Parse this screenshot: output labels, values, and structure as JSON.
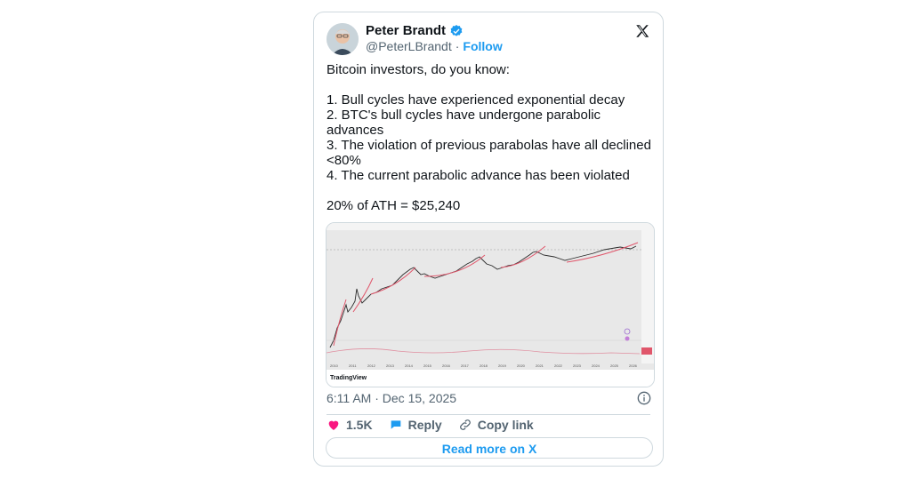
{
  "author": {
    "name": "Peter Brandt",
    "handle": "@PeterLBrandt",
    "separator": "·",
    "follow_label": "Follow"
  },
  "tweet": {
    "lines": [
      "Bitcoin investors, do you know:",
      "",
      "1. Bull cycles have experienced exponential decay",
      "2. BTC's bull cycles have undergone parabolic advances",
      "3. The violation of previous parabolas have all declined <80%",
      "4. The current parabolic advance has been violated",
      "",
      "20% of ATH = $25,240"
    ]
  },
  "media": {
    "footer_text": "TradingView",
    "x_ticks": [
      "2010",
      "2011",
      "2012",
      "2013",
      "2014",
      "2015",
      "2016",
      "2017",
      "2018",
      "2019",
      "2020",
      "2021",
      "2022",
      "2023",
      "2024",
      "2025",
      "2026"
    ]
  },
  "timestamp": {
    "time": "6:11 AM",
    "separator": "·",
    "date": "Dec 15, 2025"
  },
  "actions": {
    "likes": "1.5K",
    "reply_label": "Reply",
    "copy_label": "Copy link"
  },
  "read_more_label": "Read more on X",
  "colors": {
    "accent": "#1d9bf0",
    "like": "#f91880",
    "parabola": "#e0566b"
  }
}
